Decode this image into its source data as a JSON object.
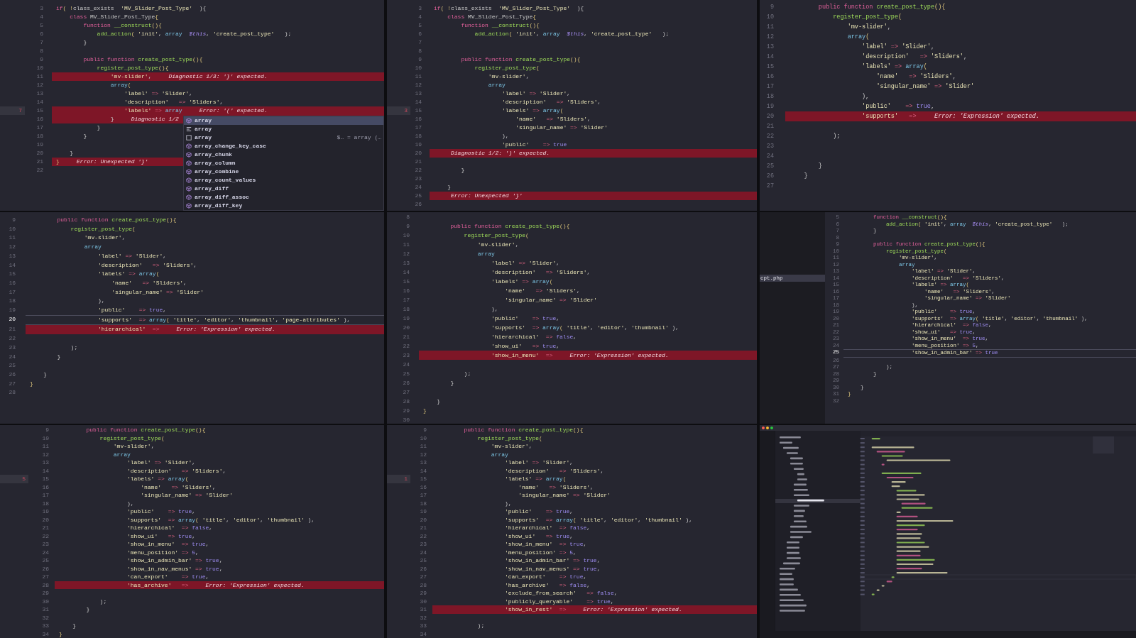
{
  "panels": [
    {
      "lines": [
        {
          "n": "3",
          "kind": "code",
          "code": "if( !class_exists  'MV_Slider_Post_Type'  ){"
        },
        {
          "n": "4",
          "kind": "code",
          "code": "    class MV_Slider_Post_Type{"
        },
        {
          "n": "5",
          "kind": "code",
          "code": "        function __construct(){"
        },
        {
          "n": "6",
          "kind": "code",
          "code": "            add_action( 'init', array  $this, 'create_post_type'   );"
        },
        {
          "n": "7",
          "kind": "code",
          "code": "        }"
        },
        {
          "n": "8",
          "kind": "code"
        },
        {
          "n": "9",
          "kind": "code",
          "code": "        public function create_post_type(){"
        },
        {
          "n": "10",
          "kind": "code",
          "code": "            register_post_type(){"
        },
        {
          "n": "11",
          "kind": "error",
          "code": "                'mv-slider',",
          "message": "Diagnostic 1/3: '}' expected."
        },
        {
          "n": "12",
          "kind": "code",
          "code": "                array("
        },
        {
          "n": "13",
          "kind": "code",
          "code": "                    'label' => 'Slider',"
        },
        {
          "n": "14",
          "kind": "code",
          "code": "                    'description'   => 'Sliders',"
        },
        {
          "n": "15",
          "kind": "error",
          "code": "                    'labels' => array",
          "message": "Error: '(' expected.",
          "gutter_mark": "7"
        },
        {
          "n": "16",
          "kind": "error",
          "code": "                }",
          "message": "Diagnostic 1/2"
        },
        {
          "n": "17",
          "kind": "code",
          "code": "            }"
        },
        {
          "n": "18",
          "kind": "code",
          "code": "        }"
        },
        {
          "n": "19",
          "kind": "code"
        },
        {
          "n": "20",
          "kind": "code",
          "code": "    }"
        },
        {
          "n": "21",
          "kind": "error",
          "code": "}",
          "message": "Error: Unexpected '}'"
        },
        {
          "n": "22",
          "kind": "code"
        }
      ],
      "completions": [
        {
          "label": "array",
          "kind": "function",
          "selected": true
        },
        {
          "label": "array",
          "kind": "snippet",
          "selected": false
        },
        {
          "label": "array",
          "kind": "keyword",
          "selected": false,
          "detail": "$… = array (…"
        },
        {
          "label": "array_change_key_case",
          "kind": "function",
          "selected": false
        },
        {
          "label": "array_chunk",
          "kind": "function",
          "selected": false
        },
        {
          "label": "array_column",
          "kind": "function",
          "selected": false
        },
        {
          "label": "array_combine",
          "kind": "function",
          "selected": false
        },
        {
          "label": "array_count_values",
          "kind": "function",
          "selected": false
        },
        {
          "label": "array_diff",
          "kind": "function",
          "selected": false
        },
        {
          "label": "array_diff_assoc",
          "kind": "function",
          "selected": false
        },
        {
          "label": "array_diff_key",
          "kind": "function",
          "selected": false
        }
      ]
    },
    {
      "lines": [
        {
          "n": "3",
          "kind": "code",
          "code": "if( !class_exists  'MV_Slider_Post_Type'  ){"
        },
        {
          "n": "4",
          "kind": "code",
          "code": "    class MV_Slider_Post_Type{"
        },
        {
          "n": "5",
          "kind": "code",
          "code": "        function __construct(){"
        },
        {
          "n": "6",
          "kind": "code",
          "code": "            add_action( 'init', array  $this, 'create_post_type'   );"
        },
        {
          "n": "7",
          "kind": "code"
        },
        {
          "n": "8",
          "kind": "code"
        },
        {
          "n": "9",
          "kind": "code",
          "code": "        public function create_post_type(){"
        },
        {
          "n": "10",
          "kind": "code",
          "code": "            register_post_type("
        },
        {
          "n": "11",
          "kind": "code",
          "code": "                'mv-slider',"
        },
        {
          "n": "12",
          "kind": "code",
          "code": "                array"
        },
        {
          "n": "13",
          "kind": "code",
          "code": "                    'label' => 'Slider',"
        },
        {
          "n": "14",
          "kind": "code",
          "code": "                    'description'   => 'Sliders',"
        },
        {
          "n": "15",
          "kind": "code",
          "code": "                    'labels' => array(",
          "gutter_mark": "3"
        },
        {
          "n": "16",
          "kind": "code",
          "code": "                        'name'   => 'Sliders',"
        },
        {
          "n": "17",
          "kind": "code",
          "code": "                        'singular_name' => 'Slider'"
        },
        {
          "n": "18",
          "kind": "code",
          "code": "                    ),"
        },
        {
          "n": "19",
          "kind": "code",
          "code": "                    'public'    => true"
        },
        {
          "n": "20",
          "kind": "error",
          "message": "Diagnostic 1/2: ')' expected."
        },
        {
          "n": "21",
          "kind": "code"
        },
        {
          "n": "22",
          "kind": "code",
          "code": "        }"
        },
        {
          "n": "23",
          "kind": "code"
        },
        {
          "n": "24",
          "kind": "code",
          "code": "    }"
        },
        {
          "n": "25",
          "kind": "error",
          "message": "Error: Unexpected '}'"
        },
        {
          "n": "26",
          "kind": "code"
        }
      ]
    },
    {
      "lines": [
        {
          "n": "9",
          "kind": "code",
          "code": "        public function create_post_type(){"
        },
        {
          "n": "10",
          "kind": "code",
          "code": "            register_post_type("
        },
        {
          "n": "11",
          "kind": "code",
          "code": "                'mv-slider',"
        },
        {
          "n": "12",
          "kind": "code",
          "code": "                array("
        },
        {
          "n": "13",
          "kind": "code",
          "code": "                    'label' => 'Slider',"
        },
        {
          "n": "14",
          "kind": "code",
          "code": "                    'description'   => 'Sliders',"
        },
        {
          "n": "15",
          "kind": "code",
          "code": "                    'labels' => array("
        },
        {
          "n": "16",
          "kind": "code",
          "code": "                        'name'   => 'Sliders',"
        },
        {
          "n": "17",
          "kind": "code",
          "code": "                        'singular_name' => 'Slider'"
        },
        {
          "n": "18",
          "kind": "code",
          "code": "                    ),"
        },
        {
          "n": "19",
          "kind": "code",
          "code": "                    'public'    => true,"
        },
        {
          "n": "20",
          "kind": "error",
          "code": "                    'supports'   =>",
          "message": "Error: 'Expression' expected."
        },
        {
          "n": "21",
          "kind": "code"
        },
        {
          "n": "22",
          "kind": "code",
          "code": "            );"
        },
        {
          "n": "23",
          "kind": "code"
        },
        {
          "n": "24",
          "kind": "code"
        },
        {
          "n": "25",
          "kind": "code",
          "code": "        }"
        },
        {
          "n": "26",
          "kind": "code",
          "code": "    }"
        },
        {
          "n": "27",
          "kind": "code"
        }
      ]
    },
    {
      "lines": [
        {
          "n": "9",
          "kind": "code",
          "code": "        public function create_post_type(){"
        },
        {
          "n": "10",
          "kind": "code",
          "code": "            register_post_type("
        },
        {
          "n": "11",
          "kind": "code",
          "code": "                'mv-slider',"
        },
        {
          "n": "12",
          "kind": "code",
          "code": "                array"
        },
        {
          "n": "13",
          "kind": "code",
          "code": "                    'label' => 'Slider',"
        },
        {
          "n": "14",
          "kind": "code",
          "code": "                    'description'   => 'Sliders',"
        },
        {
          "n": "15",
          "kind": "code",
          "code": "                    'labels' => array("
        },
        {
          "n": "16",
          "kind": "code",
          "code": "                        'name'   => 'Sliders',"
        },
        {
          "n": "17",
          "kind": "code",
          "code": "                        'singular_name' => 'Slider'"
        },
        {
          "n": "18",
          "kind": "code",
          "code": "                    ),"
        },
        {
          "n": "19",
          "kind": "code",
          "code": "                    'public'    => true,"
        },
        {
          "n": "20",
          "kind": "current",
          "code": "                    'supports'  => array( 'title', 'editor', 'thumbnail', 'page-attributes' ),"
        },
        {
          "n": "21",
          "kind": "error",
          "code": "                    'hierarchical'  =>",
          "message": "Error: 'Expression' expected."
        },
        {
          "n": "22",
          "kind": "code"
        },
        {
          "n": "23",
          "kind": "code",
          "code": "            );"
        },
        {
          "n": "24",
          "kind": "code",
          "code": "        }"
        },
        {
          "n": "25",
          "kind": "code"
        },
        {
          "n": "26",
          "kind": "code",
          "code": "    }"
        },
        {
          "n": "27",
          "kind": "code",
          "code": "}"
        },
        {
          "n": "28",
          "kind": "code"
        }
      ]
    },
    {
      "lines": [
        {
          "n": "8",
          "kind": "code"
        },
        {
          "n": "9",
          "kind": "code",
          "code": "        public function create_post_type(){"
        },
        {
          "n": "10",
          "kind": "code",
          "code": "            register_post_type("
        },
        {
          "n": "11",
          "kind": "code",
          "code": "                'mv-slider',"
        },
        {
          "n": "12",
          "kind": "code",
          "code": "                array"
        },
        {
          "n": "13",
          "kind": "code",
          "code": "                    'label' => 'Slider',"
        },
        {
          "n": "14",
          "kind": "code",
          "code": "                    'description'   => 'Sliders',"
        },
        {
          "n": "15",
          "kind": "code",
          "code": "                    'labels' => array("
        },
        {
          "n": "16",
          "kind": "code",
          "code": "                        'name'   => 'Sliders',"
        },
        {
          "n": "17",
          "kind": "code",
          "code": "                        'singular_name' => 'Slider'"
        },
        {
          "n": "18",
          "kind": "code",
          "code": "                    ),"
        },
        {
          "n": "19",
          "kind": "code",
          "code": "                    'public'    => true,"
        },
        {
          "n": "20",
          "kind": "code",
          "code": "                    'supports'  => array( 'title', 'editor', 'thumbnail' ),"
        },
        {
          "n": "21",
          "kind": "code",
          "code": "                    'hierarchical'  => false,"
        },
        {
          "n": "22",
          "kind": "code",
          "code": "                    'show_ui'   => true,"
        },
        {
          "n": "23",
          "kind": "error",
          "code": "                    'show_in_menu'  =>",
          "message": "Error: 'Expression' expected."
        },
        {
          "n": "24",
          "kind": "code"
        },
        {
          "n": "25",
          "kind": "code",
          "code": "            );"
        },
        {
          "n": "26",
          "kind": "code",
          "code": "        }"
        },
        {
          "n": "27",
          "kind": "code"
        },
        {
          "n": "28",
          "kind": "code",
          "code": "    }"
        },
        {
          "n": "29",
          "kind": "code",
          "code": "}"
        },
        {
          "n": "30",
          "kind": "code"
        }
      ]
    },
    {
      "sidebar_item": "cpt.php",
      "lines": [
        {
          "n": "5",
          "kind": "code",
          "code": "        function __construct(){"
        },
        {
          "n": "6",
          "kind": "code",
          "code": "            add_action( 'init', array  $this, 'create_post_type'   );"
        },
        {
          "n": "7",
          "kind": "code",
          "code": "        }"
        },
        {
          "n": "8",
          "kind": "code"
        },
        {
          "n": "9",
          "kind": "code",
          "code": "        public function create_post_type(){"
        },
        {
          "n": "10",
          "kind": "code",
          "code": "            register_post_type("
        },
        {
          "n": "11",
          "kind": "code",
          "code": "                'mv-slider',"
        },
        {
          "n": "12",
          "kind": "code",
          "code": "                array"
        },
        {
          "n": "13",
          "kind": "code",
          "code": "                    'label' => 'Slider',"
        },
        {
          "n": "14",
          "kind": "code",
          "code": "                    'description'   => 'Sliders',"
        },
        {
          "n": "15",
          "kind": "code",
          "code": "                    'labels' => array("
        },
        {
          "n": "16",
          "kind": "code",
          "code": "                        'name'   => 'Sliders',"
        },
        {
          "n": "17",
          "kind": "code",
          "code": "                        'singular_name' => 'Slider'"
        },
        {
          "n": "18",
          "kind": "code",
          "code": "                    ),"
        },
        {
          "n": "19",
          "kind": "code",
          "code": "                    'public'    => true,"
        },
        {
          "n": "20",
          "kind": "code",
          "code": "                    'supports'  => array( 'title', 'editor', 'thumbnail' ),"
        },
        {
          "n": "21",
          "kind": "code",
          "code": "                    'hierarchical'  => false,"
        },
        {
          "n": "22",
          "kind": "code",
          "code": "                    'show_ui'   => true,"
        },
        {
          "n": "23",
          "kind": "code",
          "code": "                    'show_in_menu'  => true,"
        },
        {
          "n": "24",
          "kind": "code",
          "code": "                    'menu_position' => 5,"
        },
        {
          "n": "25",
          "kind": "current",
          "code": "                    'show_in_admin_bar' => true"
        },
        {
          "n": "26",
          "kind": "code"
        },
        {
          "n": "27",
          "kind": "code",
          "code": "            );"
        },
        {
          "n": "28",
          "kind": "code",
          "code": "        }"
        },
        {
          "n": "29",
          "kind": "code"
        },
        {
          "n": "30",
          "kind": "code",
          "code": "    }"
        },
        {
          "n": "31",
          "kind": "code",
          "code": "}"
        },
        {
          "n": "32",
          "kind": "code"
        }
      ]
    },
    {
      "lines": [
        {
          "n": "9",
          "kind": "code",
          "code": "        public function create_post_type(){"
        },
        {
          "n": "10",
          "kind": "code",
          "code": "            register_post_type("
        },
        {
          "n": "11",
          "kind": "code",
          "code": "                'mv-slider',"
        },
        {
          "n": "12",
          "kind": "code",
          "code": "                array"
        },
        {
          "n": "13",
          "kind": "code",
          "code": "                    'label' => 'Slider',"
        },
        {
          "n": "14",
          "kind": "code",
          "code": "                    'description'   => 'Sliders',"
        },
        {
          "n": "15",
          "kind": "code",
          "code": "                    'labels' => array(",
          "gutter_mark": "5"
        },
        {
          "n": "16",
          "kind": "code",
          "code": "                        'name'   => 'Sliders',"
        },
        {
          "n": "17",
          "kind": "code",
          "code": "                        'singular_name' => 'Slider'"
        },
        {
          "n": "18",
          "kind": "code",
          "code": "                    ),"
        },
        {
          "n": "19",
          "kind": "code",
          "code": "                    'public'    => true,"
        },
        {
          "n": "20",
          "kind": "code",
          "code": "                    'supports'  => array( 'title', 'editor', 'thumbnail' ),"
        },
        {
          "n": "21",
          "kind": "code",
          "code": "                    'hierarchical'  => false,"
        },
        {
          "n": "22",
          "kind": "code",
          "code": "                    'show_ui'   => true,"
        },
        {
          "n": "23",
          "kind": "code",
          "code": "                    'show_in_menu'  => true,"
        },
        {
          "n": "24",
          "kind": "code",
          "code": "                    'menu_position' => 5,"
        },
        {
          "n": "25",
          "kind": "code",
          "code": "                    'show_in_admin_bar' => true,"
        },
        {
          "n": "26",
          "kind": "code",
          "code": "                    'show_in_nav_menus' => true,"
        },
        {
          "n": "27",
          "kind": "code",
          "code": "                    'can_export'    => true,"
        },
        {
          "n": "28",
          "kind": "error",
          "code": "                    'has_archive'   =>",
          "message": "Error: 'Expression' expected."
        },
        {
          "n": "29",
          "kind": "code"
        },
        {
          "n": "30",
          "kind": "code",
          "code": "            );"
        },
        {
          "n": "31",
          "kind": "code",
          "code": "        }"
        },
        {
          "n": "32",
          "kind": "code"
        },
        {
          "n": "33",
          "kind": "code",
          "code": "    }"
        },
        {
          "n": "34",
          "kind": "code",
          "code": "}"
        }
      ]
    },
    {
      "lines": [
        {
          "n": "9",
          "kind": "code",
          "code": "        public function create_post_type(){"
        },
        {
          "n": "10",
          "kind": "code",
          "code": "            register_post_type("
        },
        {
          "n": "11",
          "kind": "code",
          "code": "                'mv-slider',"
        },
        {
          "n": "12",
          "kind": "code",
          "code": "                array"
        },
        {
          "n": "13",
          "kind": "code",
          "code": "                    'label' => 'Slider',"
        },
        {
          "n": "14",
          "kind": "code",
          "code": "                    'description'   => 'Sliders',"
        },
        {
          "n": "15",
          "kind": "code",
          "code": "                    'labels' => array(",
          "gutter_mark": "1"
        },
        {
          "n": "16",
          "kind": "code",
          "code": "                        'name'   => 'Sliders',"
        },
        {
          "n": "17",
          "kind": "code",
          "code": "                        'singular_name' => 'Slider'"
        },
        {
          "n": "18",
          "kind": "code",
          "code": "                    ),"
        },
        {
          "n": "19",
          "kind": "code",
          "code": "                    'public'    => true,"
        },
        {
          "n": "20",
          "kind": "code",
          "code": "                    'supports'  => array( 'title', 'editor', 'thumbnail' ),"
        },
        {
          "n": "21",
          "kind": "code",
          "code": "                    'hierarchical'  => false,"
        },
        {
          "n": "22",
          "kind": "code",
          "code": "                    'show_ui'   => true,"
        },
        {
          "n": "23",
          "kind": "code",
          "code": "                    'show_in_menu'  => true,"
        },
        {
          "n": "24",
          "kind": "code",
          "code": "                    'menu_position' => 5,"
        },
        {
          "n": "25",
          "kind": "code",
          "code": "                    'show_in_admin_bar' => true,"
        },
        {
          "n": "26",
          "kind": "code",
          "code": "                    'show_in_nav_menus' => true,"
        },
        {
          "n": "27",
          "kind": "code",
          "code": "                    'can_export'    => true,"
        },
        {
          "n": "28",
          "kind": "code",
          "code": "                    'has_archive'   => false,"
        },
        {
          "n": "29",
          "kind": "code",
          "code": "                    'exclude_from_search'   => false,"
        },
        {
          "n": "30",
          "kind": "code",
          "code": "                    'publicly_queryable'    => true,"
        },
        {
          "n": "31",
          "kind": "error",
          "code": "                    'show_in_rest'  =>",
          "message": "Error: 'Expression' expected."
        },
        {
          "n": "32",
          "kind": "code"
        },
        {
          "n": "33",
          "kind": "code",
          "code": "            );"
        },
        {
          "n": "34",
          "kind": "code"
        }
      ]
    }
  ]
}
